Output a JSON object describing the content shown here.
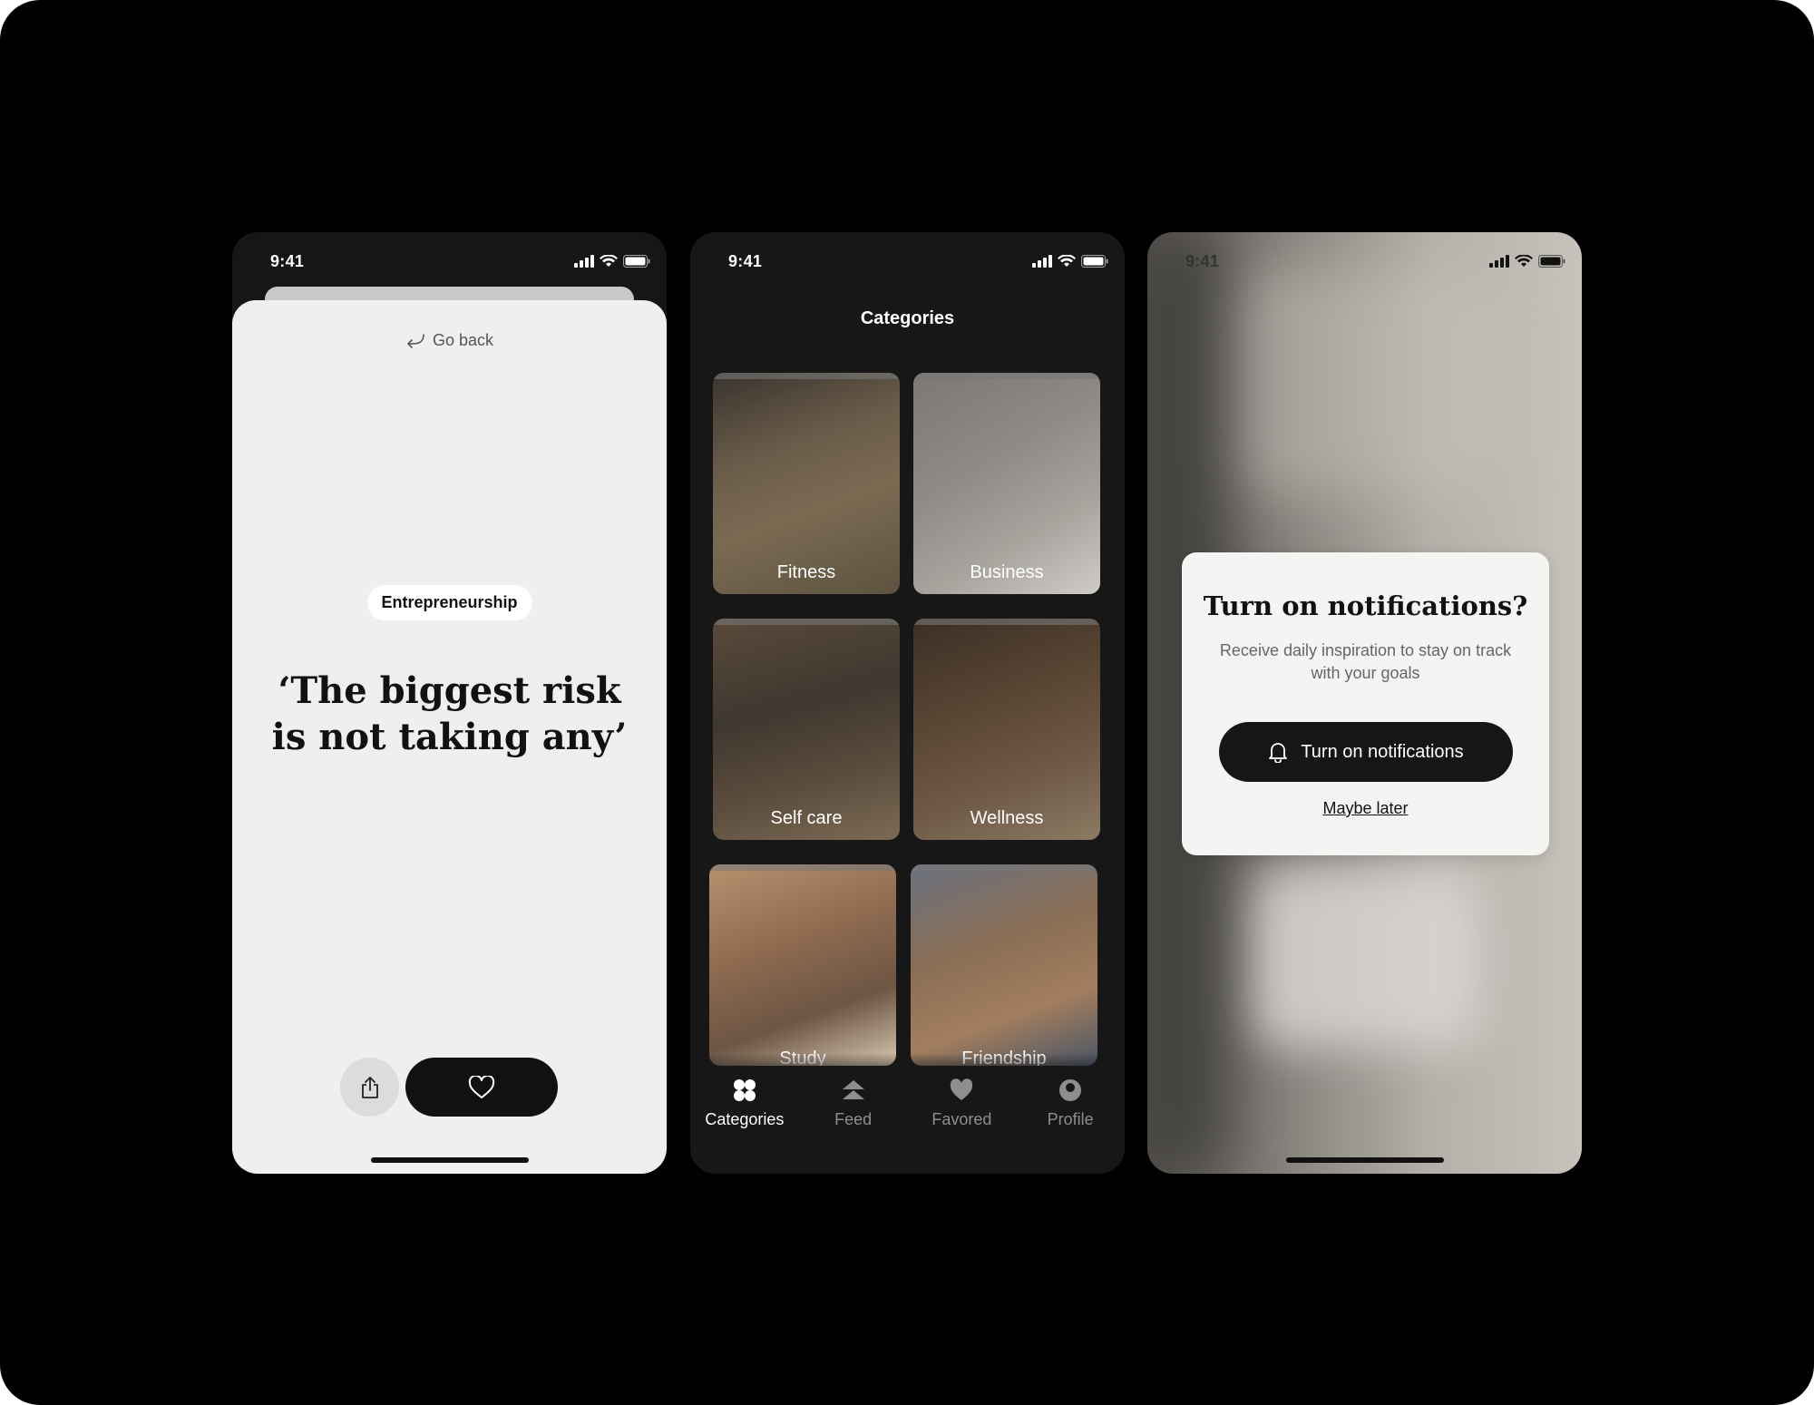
{
  "screens": {
    "quote": {
      "status_time": "9:41",
      "go_back": "Go back",
      "category_chip": "Entrepreneurship",
      "quote_text": "‘The biggest risk is not taking any’",
      "icons": [
        "share-icon",
        "heart-icon",
        "back-arrow-icon"
      ]
    },
    "categories": {
      "status_time": "9:41",
      "title": "Categories",
      "tiles": [
        {
          "label": "Fitness"
        },
        {
          "label": "Business"
        },
        {
          "label": "Self care"
        },
        {
          "label": "Wellness"
        },
        {
          "label": "Study"
        },
        {
          "label": "Friendship"
        }
      ],
      "tabs": [
        {
          "label": "Categories",
          "icon": "grid-icon",
          "active": true
        },
        {
          "label": "Feed",
          "icon": "feed-icon",
          "active": false
        },
        {
          "label": "Favored",
          "icon": "heart-icon",
          "active": false
        },
        {
          "label": "Profile",
          "icon": "profile-icon",
          "active": false
        }
      ]
    },
    "notifications": {
      "status_time": "9:41",
      "modal_title": "Turn on notifications?",
      "modal_description": "Receive daily inspiration to stay on track with your goals",
      "primary_button": "Turn on notifications",
      "secondary_link": "Maybe later",
      "icons": [
        "bell-icon"
      ]
    }
  },
  "colors": {
    "background": "#000000",
    "light_surface": "#efefef",
    "dark_surface": "#171717",
    "button_dark": "#111111"
  }
}
